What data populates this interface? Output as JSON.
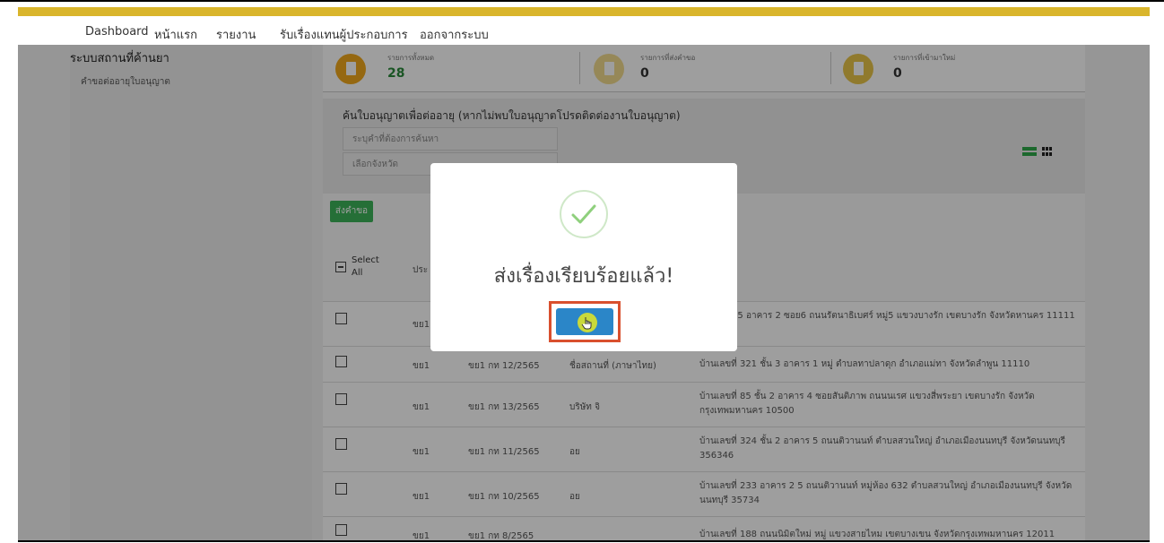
{
  "nav": {
    "items": [
      "Dashboard",
      "หน้าแรก",
      "รายงาน",
      "รับเรื่องแทนผู้ประกอบการ",
      "ออกจากระบบ"
    ]
  },
  "sidebar": {
    "title": "ระบบสถานที่ค้านยา",
    "link": "คำขอต่ออายุใบอนุญาต"
  },
  "stats": [
    {
      "label": "รายการทั้งหมด",
      "value": "28",
      "color": "#f0a81c"
    },
    {
      "label": "รายการที่ส่งคำขอ",
      "value": "0",
      "color": "#f3dc8e"
    },
    {
      "label": "รายการที่เข้ามาใหม่",
      "value": "0",
      "color": "#e8c64a"
    }
  ],
  "search": {
    "title": "ค้นใบอนุญาตเพื่อต่ออายุ (หากไม่พบใบอนุญาตโปรดติดต่องานใบอนุญาต)",
    "keyword_placeholder": "ระบุคำที่ต้องการค้นหา",
    "province_placeholder": "เลือกจังหวัด"
  },
  "submit_button": "ส่งคำขอ",
  "table": {
    "select_all": "Select All",
    "col_type": "ประ",
    "rows": [
      {
        "type": "ขย1",
        "no": "",
        "name": "",
        "addr": "44/8 ชั้น 5 อาคาร 2 ซอย6 ถนนรัตนาธิเบศร์ หมู่5 แขวงบางรัก เขตบางรัก จังหวัดหานคร 11111"
      },
      {
        "type": "ขย1",
        "no": "ขย1 กท 12/2565",
        "name": "ชื่อสถานที่ (ภาษาไทย)",
        "addr": "บ้านเลขที่ 321 ชั้น 3 อาคาร 1 หมู่ ตำบลทาปลาดุก อำเภอแม่ทา จังหวัดลำพูน 11110"
      },
      {
        "type": "ขย1",
        "no": "ขย1 กท 13/2565",
        "name": "บริษัท จิ",
        "addr": "บ้านเลขที่ 85 ชั้น 2 อาคาร 4 ซอยสันติภาพ ถนนนเรศ แขวงสี่พระยา เขตบางรัก จังหวัดกรุงเทพมหานคร 10500"
      },
      {
        "type": "ขย1",
        "no": "ขย1 กท 11/2565",
        "name": "อย",
        "addr": "บ้านเลขที่ 324 ชั้น 2 อาคาร 5 ถนนติวานนท์ ตำบลสวนใหญ่ อำเภอเมืองนนทบุรี จังหวัดนนทบุรี 356346"
      },
      {
        "type": "ขย1",
        "no": "ขย1 กท 10/2565",
        "name": "อย",
        "addr": "บ้านเลขที่ 233 อาคาร 2 5 ถนนติวานนท์ หมู่ห้อง 632 ตำบลสวนใหญ่ อำเภอเมืองนนทบุรี จังหวัดนนทบุรี 35734"
      },
      {
        "type": "ขย1",
        "no": "ขย1 กท 8/2565",
        "name": "",
        "addr": "บ้านเลขที่ 188 ถนนนิมิตใหม่ หมู่ แขวงสายไหม เขตบางเขน จังหวัดกรุงเทพมหานคร 12011"
      }
    ]
  },
  "modal": {
    "title": "ส่งเรื่องเรียบร้อยแล้ว!"
  }
}
